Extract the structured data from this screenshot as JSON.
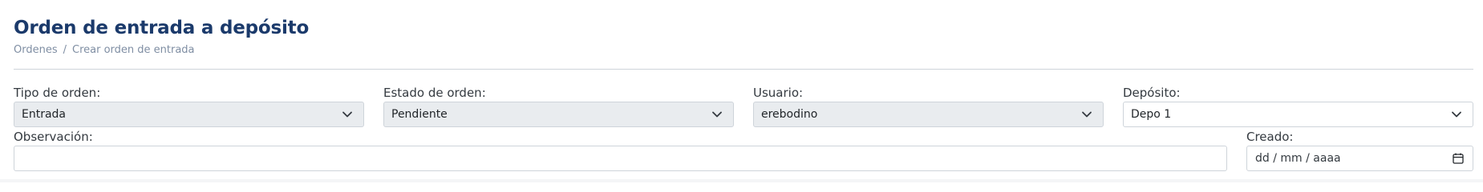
{
  "header": {
    "title": "Orden de entrada a depósito",
    "breadcrumb": [
      "Ordenes",
      "Crear orden de entrada"
    ],
    "breadcrumb_separator": "/"
  },
  "form": {
    "tipo_orden": {
      "label": "Tipo de orden:",
      "value": "Entrada"
    },
    "estado_orden": {
      "label": "Estado de orden:",
      "value": "Pendiente"
    },
    "usuario": {
      "label": "Usuario:",
      "value": "erebodino"
    },
    "deposito": {
      "label": "Depósito:",
      "value": "Depo 1"
    },
    "observacion": {
      "label": "Observación:",
      "value": ""
    },
    "creado": {
      "label": "Creado:",
      "placeholder": "dd / mm / aaaa"
    }
  },
  "colors": {
    "title": "#1b3a6b",
    "breadcrumb": "#7f8ea3",
    "disabled_bg": "#e9ecef",
    "border": "#ced4da"
  },
  "icons": {
    "select": "chevron-down-icon",
    "date": "calendar-icon"
  }
}
